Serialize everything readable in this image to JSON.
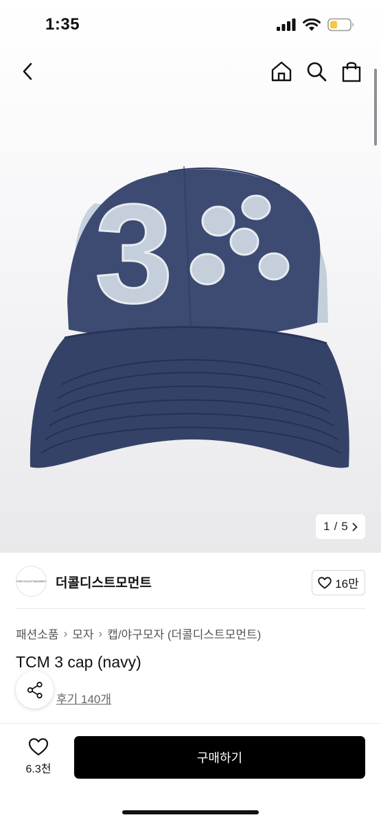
{
  "status_bar": {
    "time": "1:35"
  },
  "product_image": {
    "counter_current": "1",
    "counter_sep": "/",
    "counter_total": "5"
  },
  "shop": {
    "logo_text": "THECOOLISTMOMENT",
    "name": "더콜디스트모먼트",
    "likes": "16만"
  },
  "breadcrumb": [
    "패션소품",
    "모자",
    "캡/야구모자 (더콜디스트모먼트)"
  ],
  "product": {
    "title": "TCM 3 cap (navy)",
    "review_link": "후기 140개"
  },
  "bottom_bar": {
    "wish_count": "6.3천",
    "buy_label": "구매하기"
  },
  "colors": {
    "cap_navy": "#3c4a73",
    "patch_light": "#c9d3df",
    "buy_button": "#000000"
  },
  "icons": [
    "back-icon",
    "home-icon",
    "search-icon",
    "bag-icon",
    "heart-icon",
    "share-icon",
    "chevron-right-icon"
  ]
}
